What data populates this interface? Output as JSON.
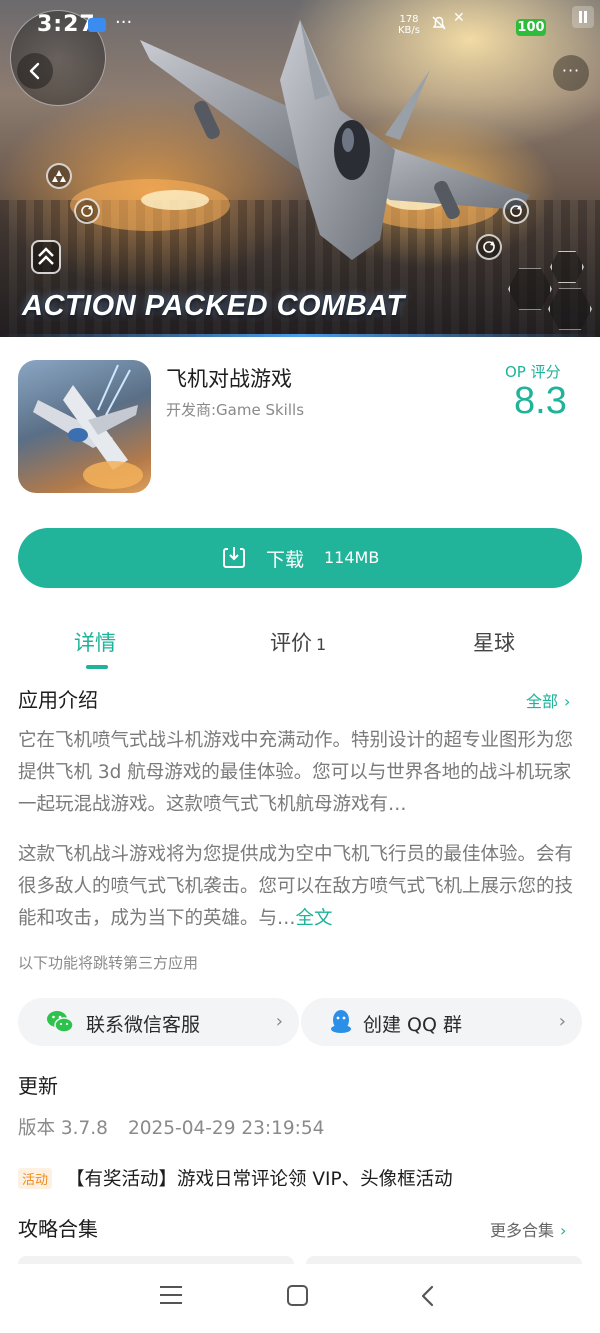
{
  "status_bar": {
    "time": "3:27",
    "speed_value": "178",
    "speed_unit": "KB/s",
    "battery": "100"
  },
  "hero": {
    "title": "ACTION PACKED COMBAT",
    "more_label": "···"
  },
  "app": {
    "name": "飞机对战游戏",
    "developer": "开发商:Game Skills",
    "rating_label": "OP 评分",
    "rating_value": "8.3"
  },
  "download": {
    "label": "下载",
    "size": "114MB"
  },
  "tabs": [
    {
      "label": "详情",
      "count": ""
    },
    {
      "label": "评价",
      "count": "1"
    },
    {
      "label": "星球",
      "count": ""
    }
  ],
  "intro": {
    "title": "应用介绍",
    "see_all": "全部",
    "paragraph1": " 它在飞机喷气式战斗机游戏中充满动作。特别设计的超专业图形为您提供飞机 3d 航母游戏的最佳体验。您可以与世界各地的战斗机玩家一起玩混战游戏。这款喷气式飞机航母游戏有…",
    "paragraph2": "这款飞机战斗游戏将为您提供成为空中飞机飞行员的最佳体验。会有很多敌人的喷气式飞机袭击。您可以在敌方喷气式飞机上展示您的技能和攻击，成为当下的英雄。与…",
    "full_text": "全文",
    "third_party_note": "以下功能将跳转第三方应用"
  },
  "actions": {
    "wechat_label": "联系微信客服",
    "qq_label": "创建 QQ 群"
  },
  "update": {
    "title": "更新",
    "version": "版本 3.7.8",
    "date": "2025-04-29 23:19:54"
  },
  "event": {
    "badge": "活动",
    "text": "【有奖活动】游戏日常评论领 VIP、头像框活动"
  },
  "guides": {
    "title": "攻略合集",
    "more": "更多合集"
  },
  "colors": {
    "accent": "#21b49a",
    "badge_orange": "#f08a1a"
  }
}
